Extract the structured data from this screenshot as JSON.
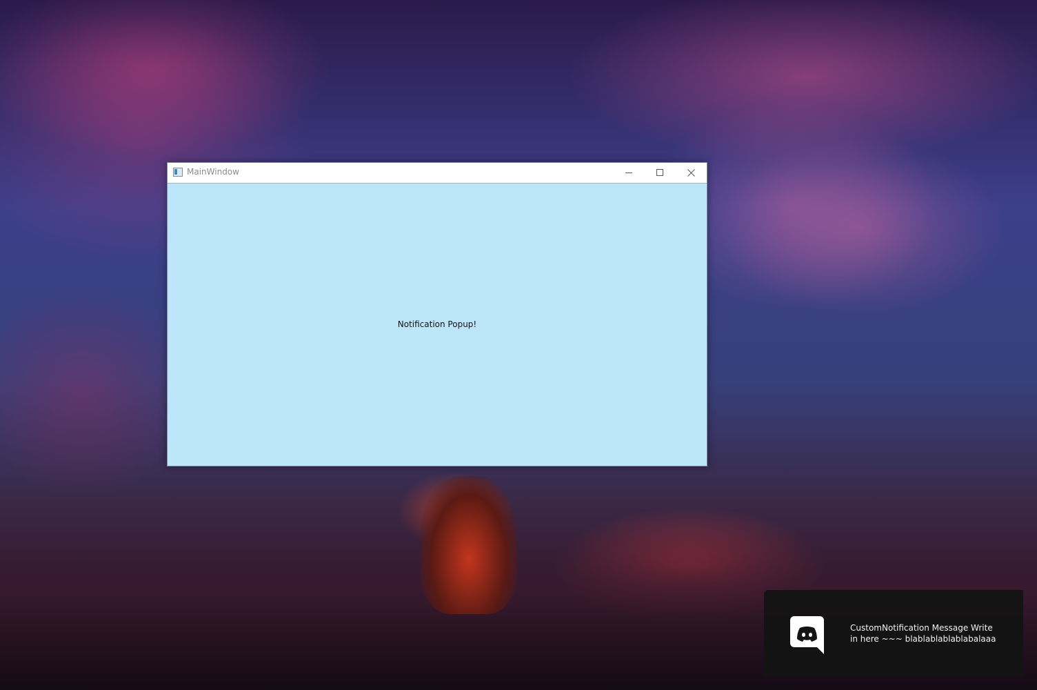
{
  "desktop": {
    "wallpaper": "enchanted-forest-cherry-blossom"
  },
  "window": {
    "title": "MainWindow",
    "icon": "app-window-icon",
    "controls": {
      "minimize": "minimize-icon",
      "maximize": "maximize-icon",
      "close": "close-icon"
    },
    "client_background": "#bde6fb",
    "label": "Notification Popup!"
  },
  "notification": {
    "icon": "discord-icon",
    "message": "CustomNotification Message Write in here ~~~ blablablablablabalaaa",
    "background": "#141414"
  }
}
